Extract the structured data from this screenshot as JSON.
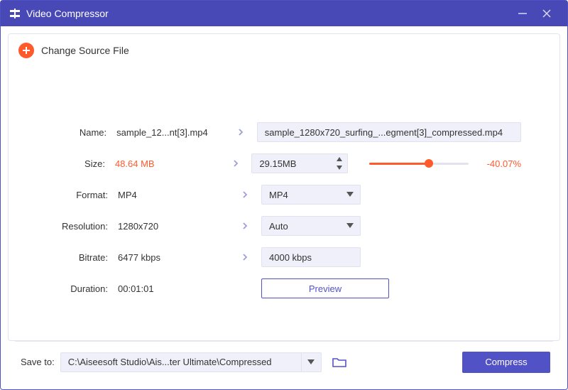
{
  "window": {
    "title": "Video Compressor"
  },
  "source": {
    "change_label": "Change Source File"
  },
  "labels": {
    "name": "Name:",
    "size": "Size:",
    "format": "Format:",
    "resolution": "Resolution:",
    "bitrate": "Bitrate:",
    "duration": "Duration:"
  },
  "values": {
    "name_src": "sample_12...nt[3].mp4",
    "name_out": "sample_1280x720_surfing_...egment[3]_compressed.mp4",
    "size_src": "48.64 MB",
    "size_out": "29.15MB",
    "size_percent": "-40.07%",
    "size_slider_pct": 60,
    "format_src": "MP4",
    "format_out": "MP4",
    "resolution_src": "1280x720",
    "resolution_out": "Auto",
    "bitrate_src": "6477 kbps",
    "bitrate_out": "4000 kbps",
    "duration": "00:01:01"
  },
  "buttons": {
    "preview": "Preview",
    "compress": "Compress"
  },
  "footer": {
    "save_label": "Save to:",
    "save_path": "C:\\Aiseesoft Studio\\Ais...ter Ultimate\\Compressed"
  }
}
